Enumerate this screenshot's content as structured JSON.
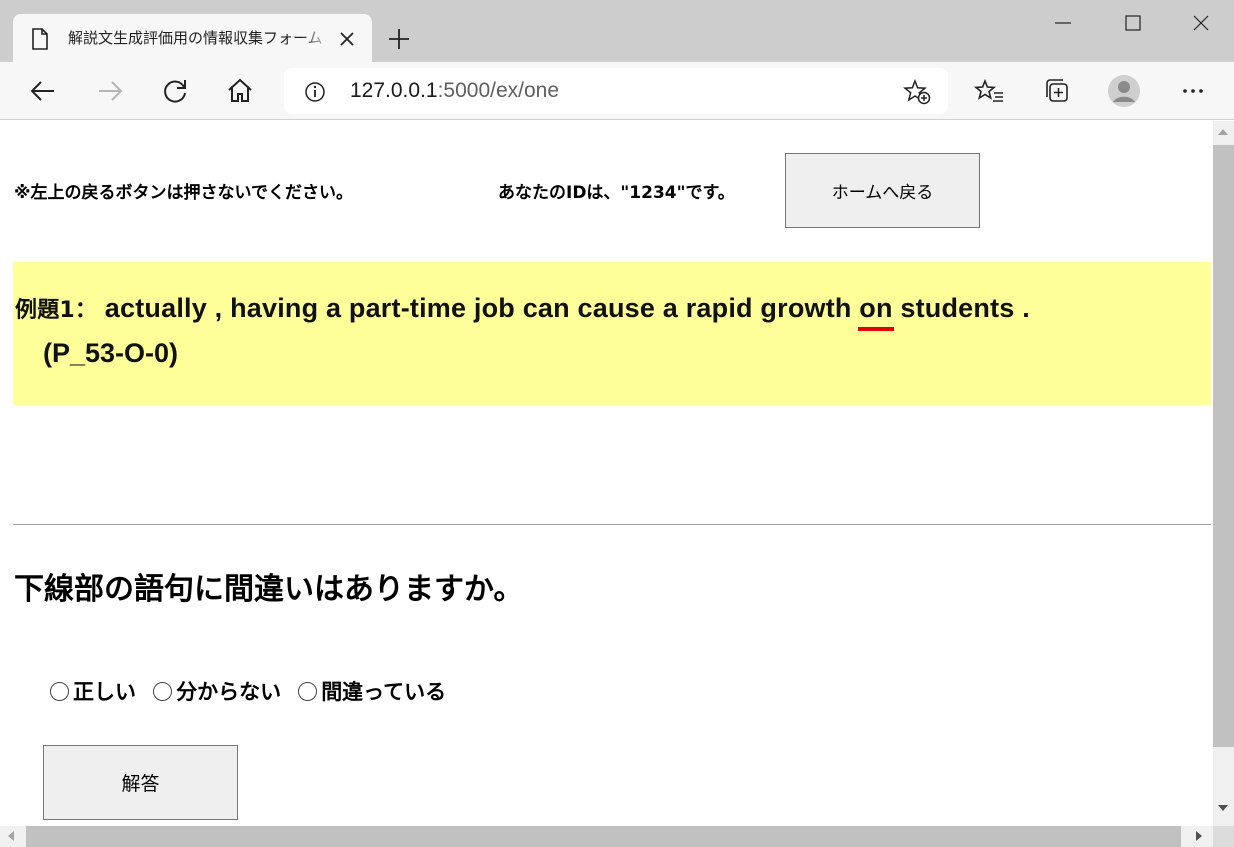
{
  "browser": {
    "tab": {
      "title": "解説文生成評価用の情報収集フォーム"
    },
    "address": {
      "host": "127.0.0.1",
      "path": ":5000/ex/one"
    }
  },
  "page": {
    "notice": "※左上の戻るボタンは押さないでください。",
    "id_text": "あなたのIDは、\"1234\"です。",
    "home_button": "ホームへ戻る",
    "problem": {
      "label": "例題1：",
      "before": " actually , having a part-time job can cause a rapid growth ",
      "underlined": "on",
      "after": " students .",
      "code": "(P_53-O-0)",
      "underline_color": "#e00000",
      "highlight_color": "#ffff99"
    },
    "question": "下線部の語句に間違いはありますか。",
    "options": [
      "正しい",
      "分からない",
      "間違っている"
    ],
    "answer_button": "解答"
  }
}
